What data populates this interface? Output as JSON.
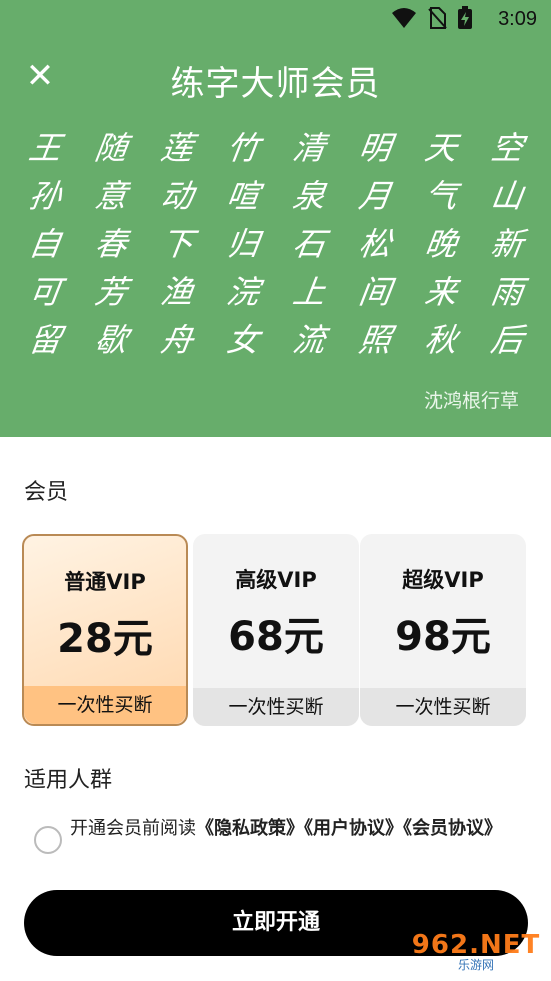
{
  "status_bar": {
    "time": "3:09"
  },
  "header": {
    "title": "练字大师会员",
    "calligraphy_chars": [
      "王",
      "随",
      "莲",
      "竹",
      "清",
      "明",
      "天",
      "空",
      "孙",
      "意",
      "动",
      "喧",
      "泉",
      "月",
      "气",
      "山",
      "自",
      "春",
      "下",
      "归",
      "石",
      "松",
      "晚",
      "新",
      "可",
      "芳",
      "渔",
      "浣",
      "上",
      "间",
      "来",
      "雨",
      "留",
      "歇",
      "舟",
      "女",
      "流",
      "照",
      "秋",
      "后"
    ],
    "attribution": "沈鸿根行草"
  },
  "membership": {
    "section_title": "会员",
    "plans": [
      {
        "name": "普通VIP",
        "price": "28元",
        "note": "一次性买断",
        "selected": true
      },
      {
        "name": "高级VIP",
        "price": "68元",
        "note": "一次性买断",
        "selected": false
      },
      {
        "name": "超级VIP",
        "price": "98元",
        "note": "一次性买断",
        "selected": false
      }
    ]
  },
  "audience": {
    "section_title": "适用人群"
  },
  "agreement": {
    "prefix": "开通会员前阅读",
    "privacy": "《隐私政策》",
    "user": "《用户协议》",
    "member": "《会员协议》"
  },
  "cta": {
    "label": "立即开通"
  },
  "watermark": {
    "main": "962.NET",
    "sub": "乐游网"
  },
  "colors": {
    "header_bg": "#67ad6b",
    "selected_plan": "#ffd7ad",
    "cta_bg": "#000000"
  }
}
